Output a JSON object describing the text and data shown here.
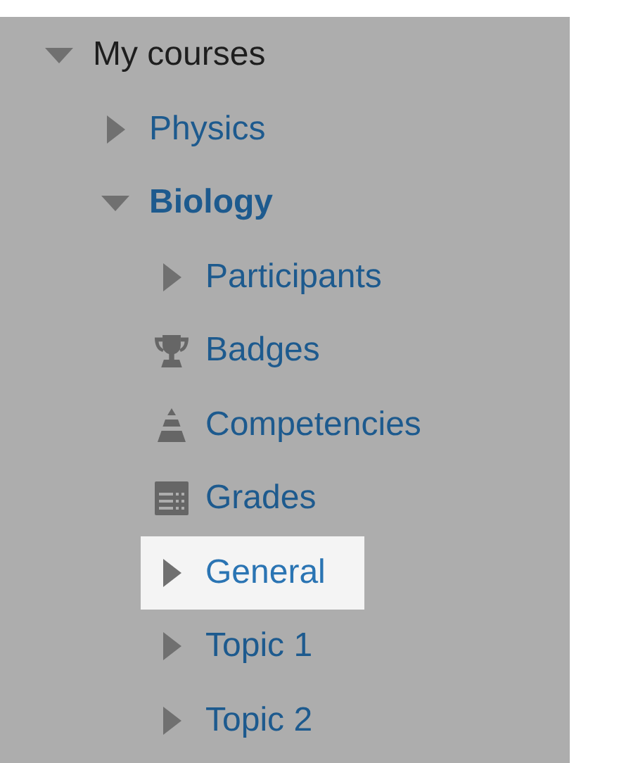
{
  "tree": [
    {
      "label": "My courses",
      "kind": "node",
      "link": false,
      "expanded": true,
      "current": false,
      "selected": false,
      "children": [
        {
          "label": "Physics",
          "kind": "node",
          "link": true,
          "expanded": false,
          "current": false,
          "selected": false
        },
        {
          "label": "Biology",
          "kind": "node",
          "link": true,
          "expanded": true,
          "current": true,
          "selected": false,
          "children": [
            {
              "label": "Participants",
              "kind": "node",
              "link": true,
              "expanded": false,
              "current": false,
              "selected": false
            },
            {
              "label": "Badges",
              "kind": "trophy",
              "link": true,
              "current": false,
              "selected": false
            },
            {
              "label": "Competencies",
              "kind": "pyramid",
              "link": true,
              "current": false,
              "selected": false
            },
            {
              "label": "Grades",
              "kind": "table",
              "link": true,
              "current": false,
              "selected": false
            },
            {
              "label": "General",
              "kind": "node",
              "link": true,
              "expanded": false,
              "current": false,
              "selected": true
            },
            {
              "label": "Topic 1",
              "kind": "node",
              "link": true,
              "expanded": false,
              "current": false,
              "selected": false
            },
            {
              "label": "Topic 2",
              "kind": "node",
              "link": true,
              "expanded": false,
              "current": false,
              "selected": false
            }
          ]
        }
      ]
    }
  ]
}
